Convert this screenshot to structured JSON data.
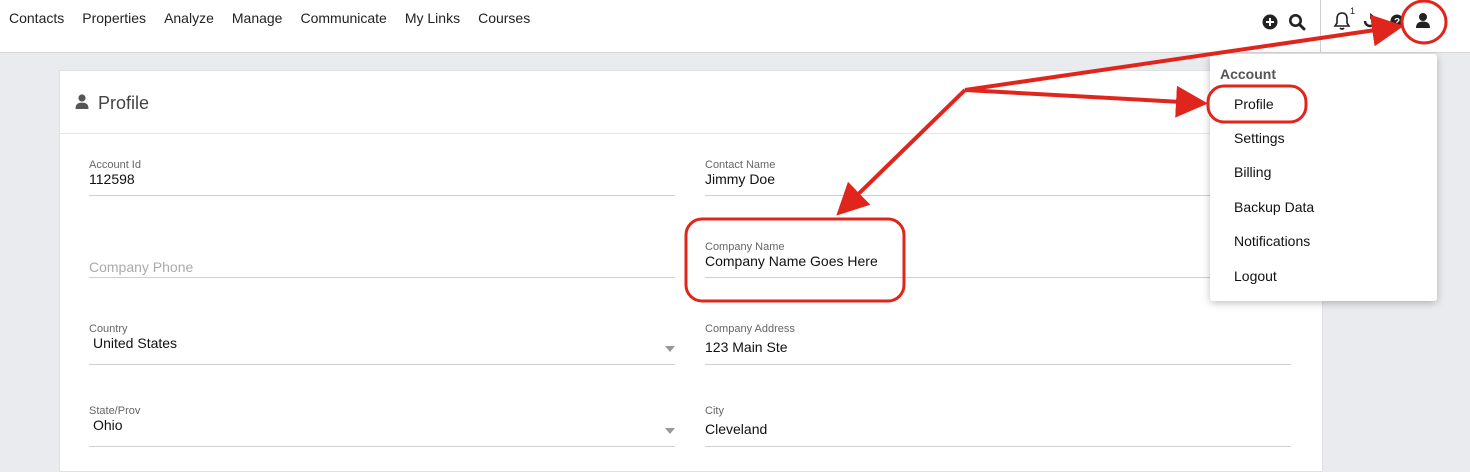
{
  "nav": {
    "items": [
      "Contacts",
      "Properties",
      "Analyze",
      "Manage",
      "Communicate",
      "My Links",
      "Courses"
    ],
    "notification_count": "1"
  },
  "icons": {
    "add": "plus-circle-icon",
    "search": "search-icon",
    "notifications": "bell-icon",
    "refresh": "refresh-icon",
    "help": "question-icon",
    "user": "user-icon"
  },
  "profile": {
    "title": "Profile",
    "fields": {
      "account_id": {
        "label": "Account Id",
        "value": "112598"
      },
      "contact_name": {
        "label": "Contact Name",
        "value": "Jimmy Doe"
      },
      "company_phone": {
        "placeholder": "Company Phone"
      },
      "company_name": {
        "label": "Company Name",
        "value": "Company Name Goes Here"
      },
      "country": {
        "label": "Country",
        "value": "United States"
      },
      "company_address": {
        "label": "Company Address",
        "value": "123 Main Ste"
      },
      "state": {
        "label": "State/Prov",
        "value": "Ohio"
      },
      "city": {
        "label": "City",
        "value": "Cleveland"
      }
    }
  },
  "account_menu": {
    "header": "Account",
    "items": [
      "Profile",
      "Settings",
      "Billing",
      "Backup Data",
      "Notifications",
      "Logout"
    ]
  },
  "colors": {
    "annotation": "#e0261c",
    "background": "#e9ebef"
  }
}
